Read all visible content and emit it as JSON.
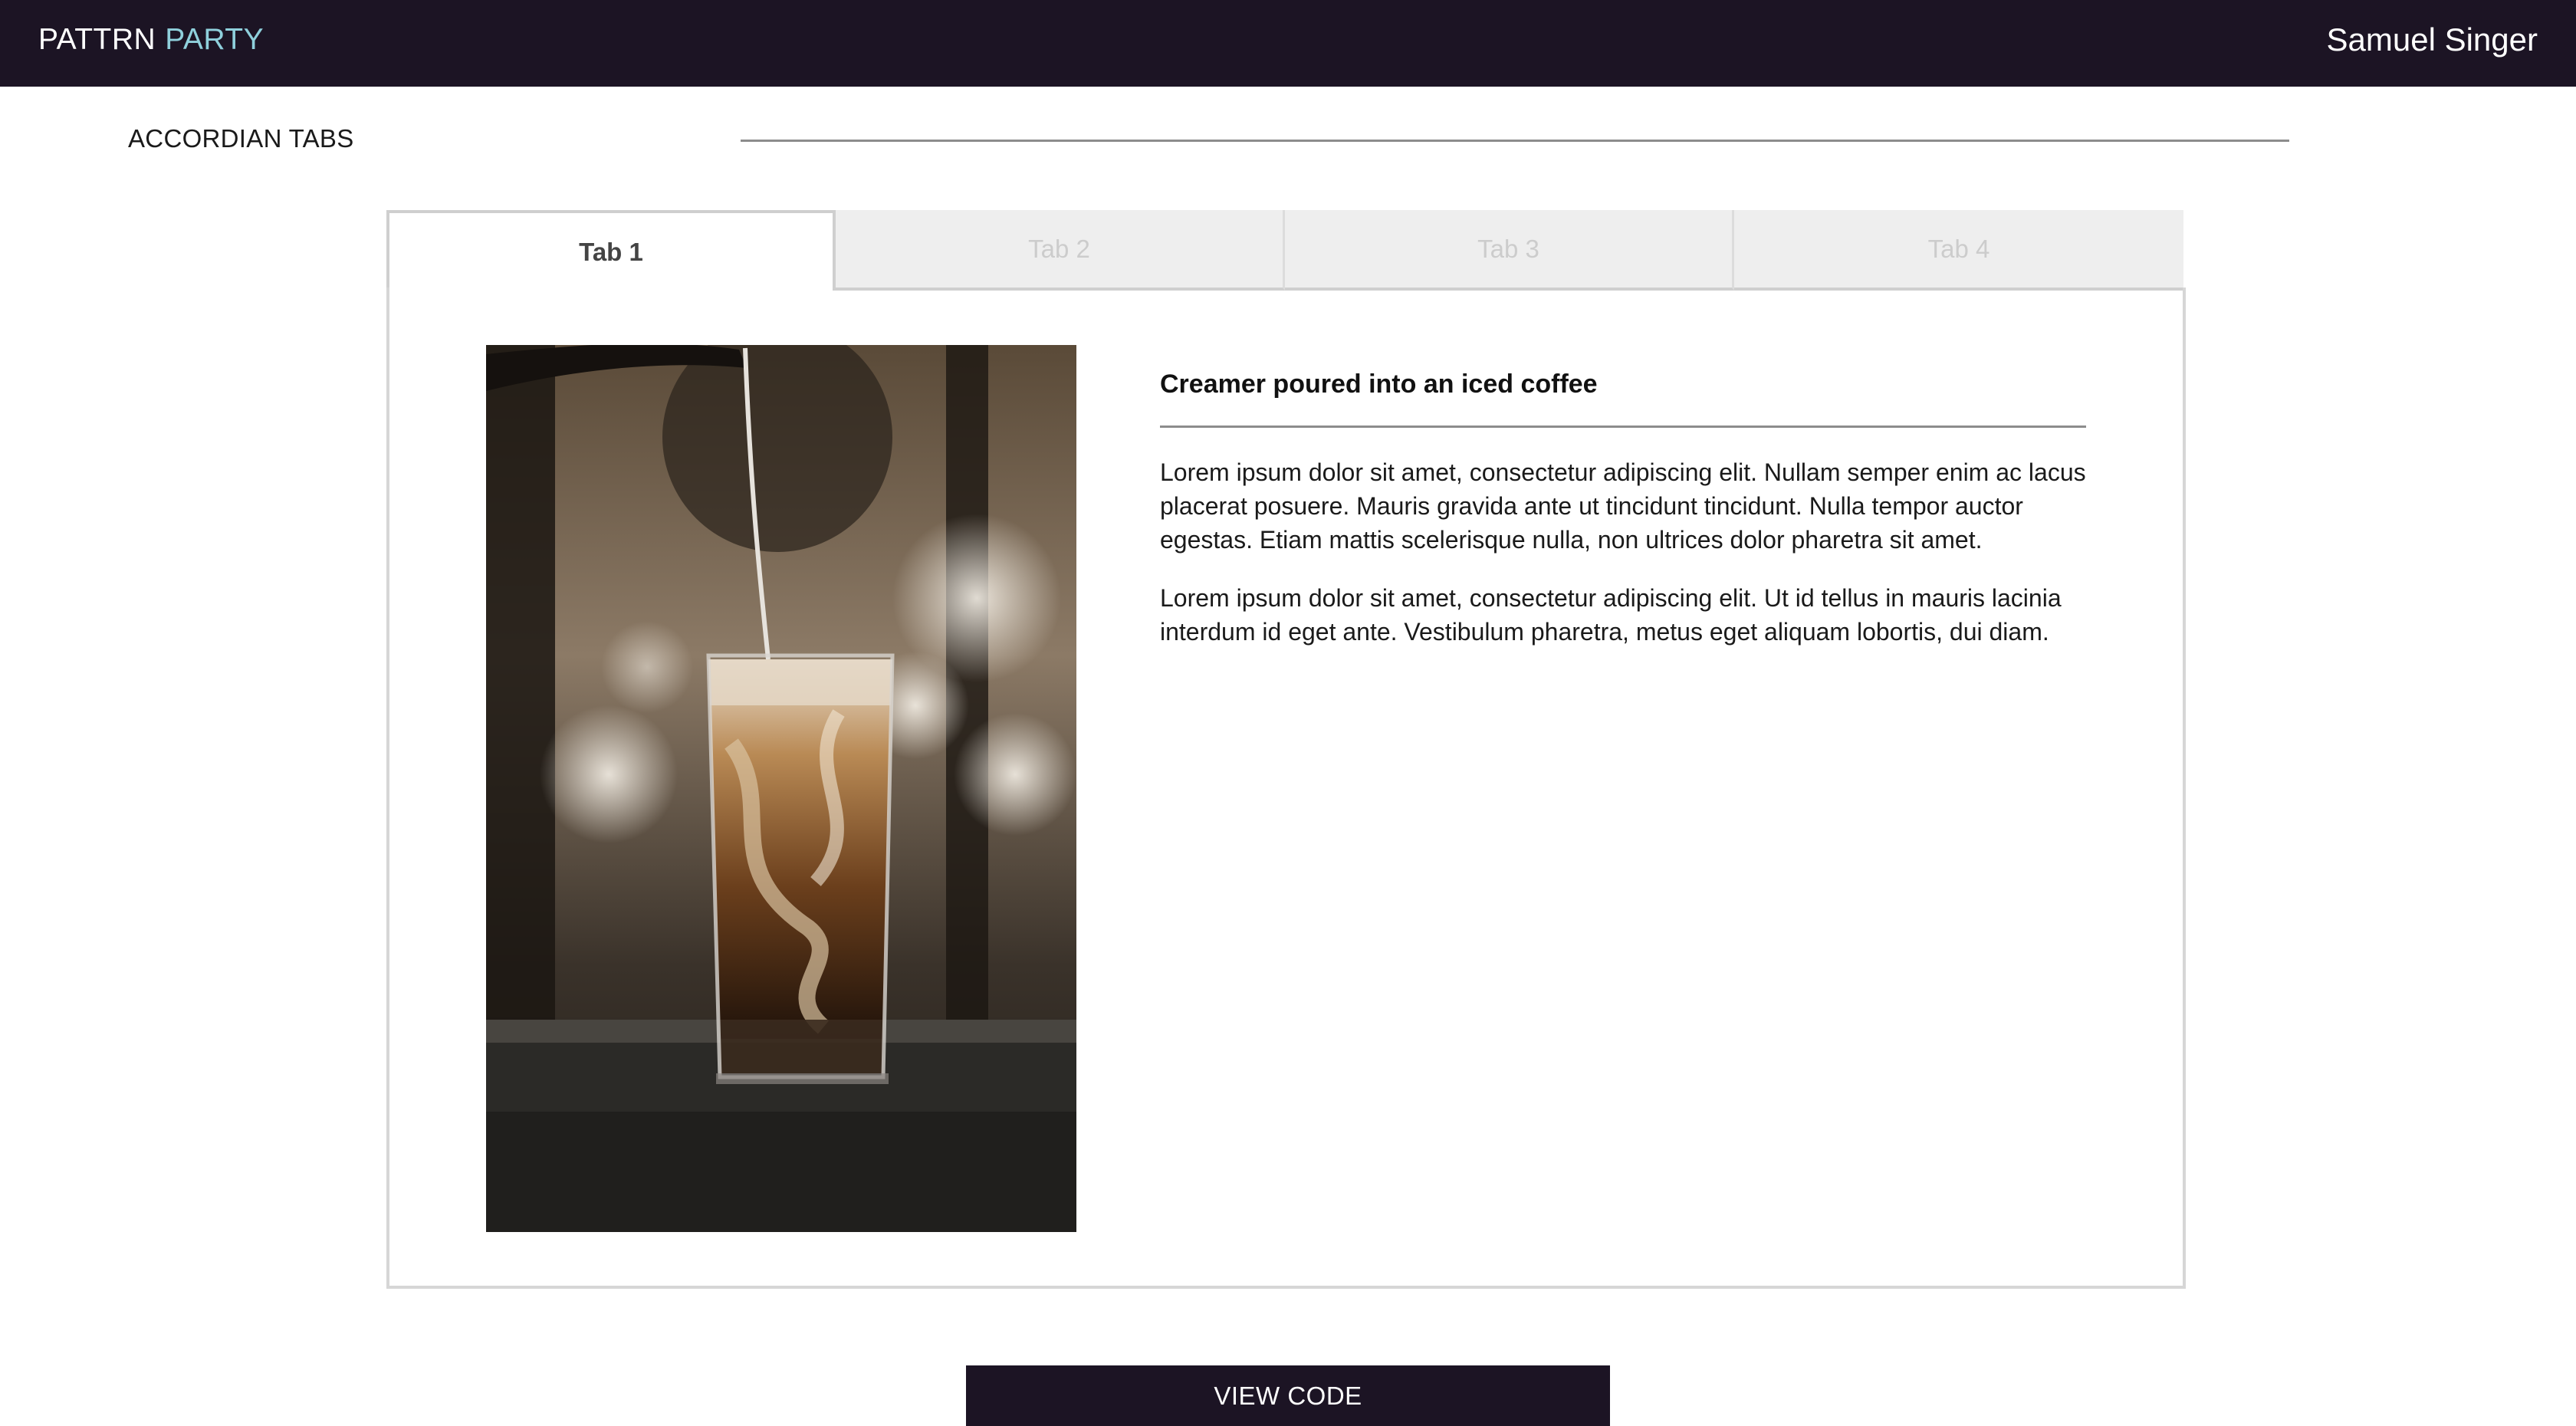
{
  "header": {
    "brand_primary": "PATTRN",
    "brand_accent": "PARTY",
    "user_name": "Samuel Singer"
  },
  "section": {
    "title": "ACCORDIAN TABS"
  },
  "tabs": [
    {
      "label": "Tab 1",
      "active": true
    },
    {
      "label": "Tab 2",
      "active": false
    },
    {
      "label": "Tab 3",
      "active": false
    },
    {
      "label": "Tab 4",
      "active": false
    }
  ],
  "panel": {
    "heading": "Creamer poured into an iced coffee",
    "paragraphs": [
      "Lorem ipsum dolor sit amet, consectetur adipiscing elit. Nullam semper enim ac lacus placerat posuere. Mauris gravida ante ut tincidunt tincidunt. Nulla tempor auctor egestas. Etiam mattis scelerisque nulla, non ultrices dolor pharetra sit amet.",
      "Lorem ipsum dolor sit amet, consectetur adipiscing elit. Ut id tellus in mauris lacinia interdum id eget ante. Vestibulum pharetra, metus eget aliquam lobortis, dui diam."
    ]
  },
  "footer": {
    "view_code_label": "VIEW CODE"
  },
  "colors": {
    "header_bg": "#1c1424",
    "brand_accent": "#8fd0dc",
    "tab_inactive_bg": "#eeeeee",
    "tab_inactive_text": "#cccccc"
  }
}
